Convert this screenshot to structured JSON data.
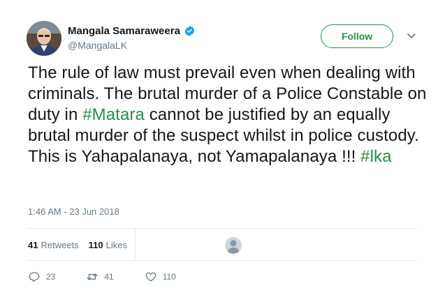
{
  "author": {
    "name": "Mangala Samaraweera",
    "handle": "@MangalaLK",
    "verified_icon": "verified-badge-icon"
  },
  "header": {
    "follow_label": "Follow",
    "menu_icon": "chevron-down-icon"
  },
  "tweet": {
    "segments": [
      {
        "type": "text",
        "value": "The rule of law must prevail even when dealing with criminals. The brutal murder of a Police Constable on duty in "
      },
      {
        "type": "hashtag",
        "value": "#Matara"
      },
      {
        "type": "text",
        "value": " cannot be justified by an equally brutal murder of the suspect whilst in police custody. This is Yahapalanaya, not Yamapalanaya !!! "
      },
      {
        "type": "hashtag",
        "value": "#lka"
      }
    ],
    "timestamp": "1:46 AM - 23 Jun 2018"
  },
  "stats": {
    "retweets_count": "41",
    "retweets_label": "Retweets",
    "likes_count": "110",
    "likes_label": "Likes"
  },
  "actions": {
    "replies": "23",
    "retweets": "41",
    "likes": "110"
  },
  "colors": {
    "accent": "#2a8c4a",
    "secondary_text": "#657786",
    "divider": "#e6ecf0"
  }
}
